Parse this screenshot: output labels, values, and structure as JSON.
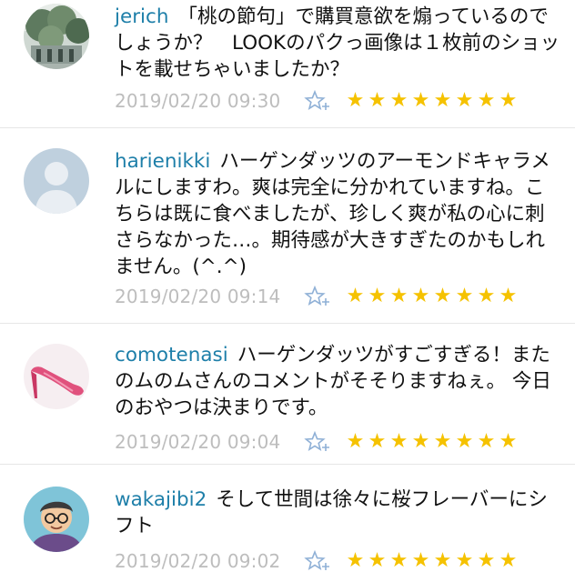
{
  "comments": [
    {
      "username": "jerich",
      "text": "「桃の節句」で購買意欲を煽っているのでしょうか？　LOOKのパクっ画像は１枚前のショットを載せちゃいましたか？",
      "timestamp": "2019/02/20 09:30",
      "avatar_icon": "tree-photo-avatar"
    },
    {
      "username": "harienikki",
      "text": "ハーゲンダッツのアーモンドキャラメルにしますわ。爽は完全に分かれていますね。こちらは既に食べましたが、珍しく爽が私の心に刺さらなかった…。期待感が大きすぎたのかもしれません。(^.^)",
      "timestamp": "2019/02/20 09:14",
      "avatar_icon": "default-person-avatar"
    },
    {
      "username": "comotenasi",
      "text": "ハーゲンダッツがすごすぎる！またのムのムさんのコメントがそそりますねぇ。 今日のおやつは決まりです。",
      "timestamp": "2019/02/20 09:04",
      "avatar_icon": "pink-heel-avatar"
    },
    {
      "username": "wakajibi2",
      "text": "そして世間は徐々に桜フレーバーにシフト",
      "timestamp": "2019/02/20 09:02",
      "avatar_icon": "cartoon-man-avatar"
    }
  ],
  "rating": {
    "stars_glyph": "★",
    "star_count": 8,
    "star_color": "#f5c200",
    "favorite_icon": "star-plus-icon"
  },
  "colors": {
    "username": "#1e7fa9",
    "timestamp": "#bdbdbd",
    "text": "#111111"
  }
}
